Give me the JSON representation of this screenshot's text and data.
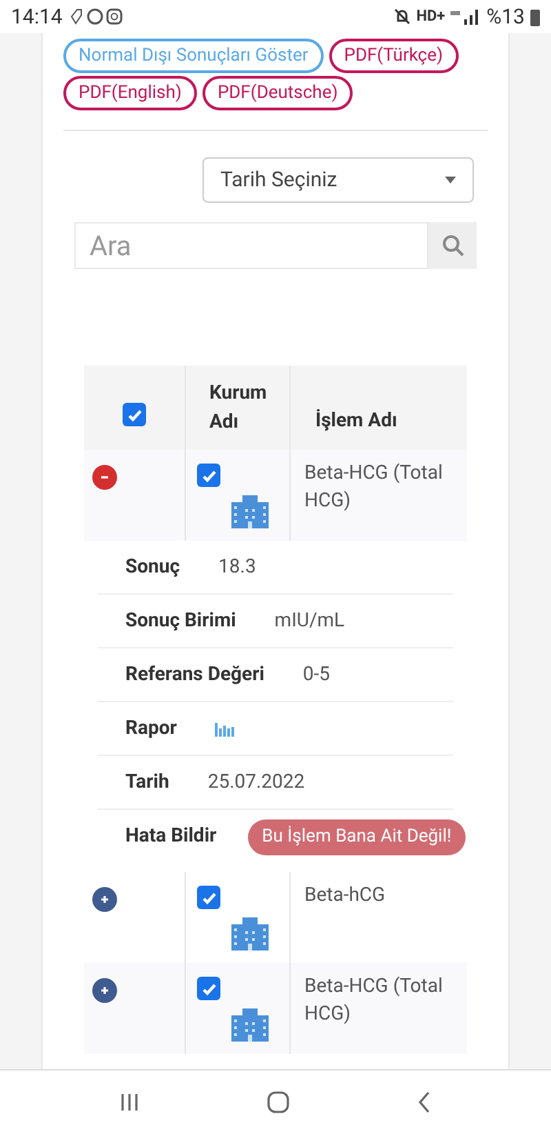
{
  "status_bar": {
    "time": "14:14",
    "network": "HD+",
    "battery": "%13"
  },
  "filter_buttons": [
    {
      "label": "Normal Dışı Sonuçları Göster",
      "kind": "info"
    },
    {
      "label": "PDF(Türkçe)",
      "kind": "pdf"
    },
    {
      "label": "PDF(English)",
      "kind": "pdf"
    },
    {
      "label": "PDF(Deutsche)",
      "kind": "pdf"
    }
  ],
  "date_select": {
    "value": "Tarih Seçiniz"
  },
  "search": {
    "placeholder": "Ara"
  },
  "table": {
    "select_all_checked": true,
    "columns": [
      "Kurum Adı",
      "İşlem Adı"
    ],
    "rows": [
      {
        "expanded": true,
        "checked": true,
        "name": "Beta-HCG (Total HCG)",
        "details": [
          {
            "label": "Sonuç",
            "value": "18.3",
            "kind": "text"
          },
          {
            "label": "Sonuç Birimi",
            "value": "mIU/mL",
            "kind": "text"
          },
          {
            "label": "Referans Değeri",
            "value": "0-5",
            "kind": "text"
          },
          {
            "label": "Rapor",
            "kind": "report"
          },
          {
            "label": "Tarih",
            "value": "25.07.2022",
            "kind": "text"
          },
          {
            "label": "Hata Bildir",
            "value": "Bu İşlem Bana Ait Değil!",
            "kind": "button"
          }
        ]
      },
      {
        "expanded": false,
        "checked": true,
        "name": "Beta-hCG"
      },
      {
        "expanded": false,
        "checked": true,
        "name": "Beta-HCG (Total HCG)"
      }
    ]
  }
}
